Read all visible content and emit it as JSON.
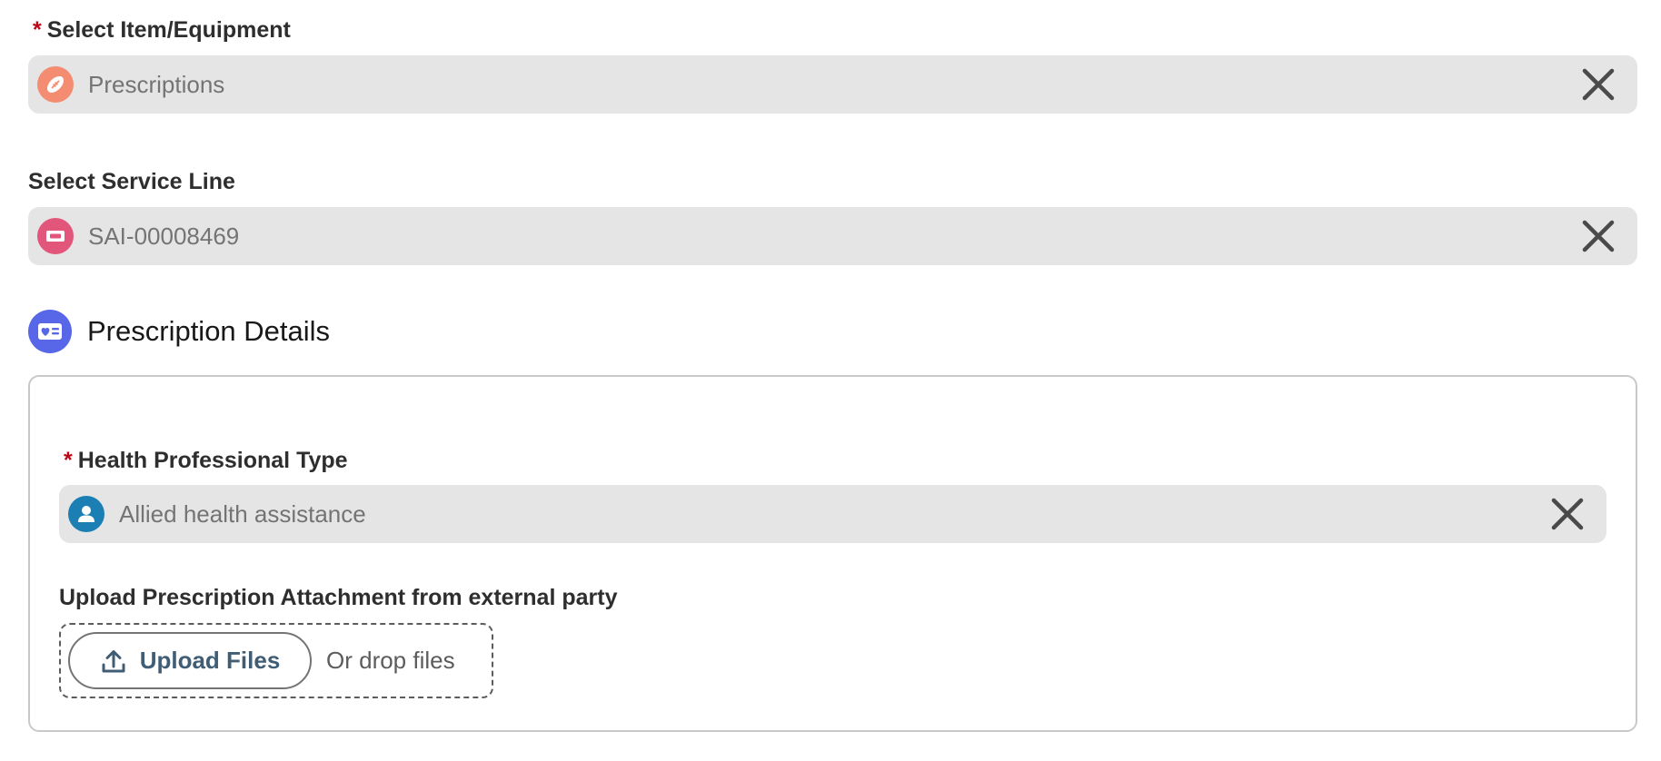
{
  "fields": {
    "item_equipment": {
      "required_mark": "*",
      "label": "Select Item/Equipment",
      "value": "Prescriptions",
      "icon": "football-icon",
      "icon_color": "#f38c70"
    },
    "service_line": {
      "label": "Select Service Line",
      "value": "SAI-00008469",
      "icon": "ticket-icon",
      "icon_color": "#e3567c"
    }
  },
  "section": {
    "title": "Prescription Details",
    "icon": "id-card-heart-icon",
    "icon_color": "#5867e8"
  },
  "details": {
    "health_professional_type": {
      "required_mark": "*",
      "label": "Health Professional Type",
      "value": "Allied health assistance",
      "icon": "user-icon",
      "icon_color": "#1b7fb3"
    },
    "upload": {
      "label": "Upload Prescription Attachment from external party",
      "button_label": "Upload Files",
      "drop_text": "Or drop files",
      "icon": "upload-icon"
    }
  },
  "colors": {
    "required": "#ba0517",
    "pill_background": "#e5e5e5",
    "value_text": "#747474",
    "upload_button_text": "#3f5d75"
  }
}
